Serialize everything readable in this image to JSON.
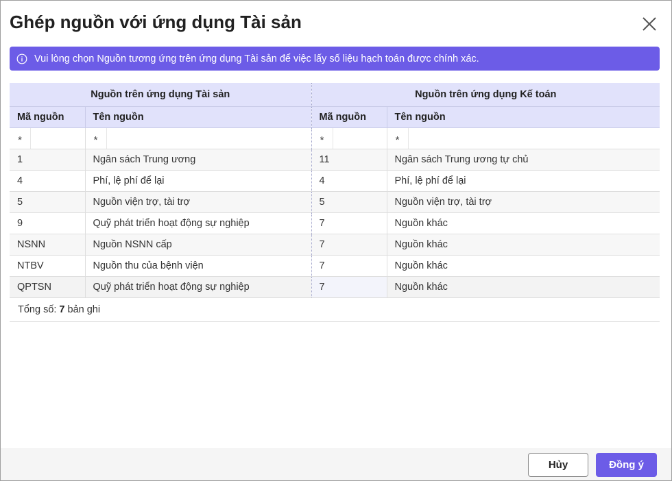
{
  "dialog": {
    "title": "Ghép nguồn với ứng dụng Tài sản",
    "close_icon": "close-icon"
  },
  "banner": {
    "icon": "info-icon",
    "text": "Vui lòng chọn Nguồn tương ứng trên ứng dụng Tài sản để việc lấy số liệu hạch toán được chính xác.",
    "color": "#6c5ce7"
  },
  "table": {
    "groups": {
      "asset": "Nguồn trên ứng dụng Tài sản",
      "accounting": "Nguồn trên ứng dụng Kế toán"
    },
    "columns": {
      "asset_code": "Mã nguồn",
      "asset_name": "Tên nguồn",
      "acc_code": "Mã nguồn",
      "acc_name": "Tên nguồn"
    },
    "filter_operator": "*",
    "rows": [
      {
        "asset_code": "1",
        "asset_name": "Ngân sách Trung ương",
        "acc_code": "11",
        "acc_name": "Ngân sách Trung ương tự chủ"
      },
      {
        "asset_code": "4",
        "asset_name": "Phí, lệ phí để lại",
        "acc_code": "4",
        "acc_name": "Phí, lệ phí để lại"
      },
      {
        "asset_code": "5",
        "asset_name": "Nguồn viện trợ, tài trợ",
        "acc_code": "5",
        "acc_name": "Nguồn viện trợ, tài trợ"
      },
      {
        "asset_code": "9",
        "asset_name": "Quỹ phát triển hoạt động sự nghiệp",
        "acc_code": "7",
        "acc_name": "Nguồn khác"
      },
      {
        "asset_code": "NSNN",
        "asset_name": "Nguồn NSNN cấp",
        "acc_code": "7",
        "acc_name": "Nguồn khác"
      },
      {
        "asset_code": "NTBV",
        "asset_name": "Nguồn thu của bệnh viện",
        "acc_code": "7",
        "acc_name": "Nguồn khác"
      },
      {
        "asset_code": "QPTSN",
        "asset_name": "Quỹ phát triển hoạt động sự nghiệp",
        "acc_code": "7",
        "acc_name": "Nguồn khác"
      }
    ]
  },
  "summary": {
    "prefix": "Tổng số:",
    "count": "7",
    "suffix": "bản ghi"
  },
  "actions": {
    "cancel_label": "Hủy",
    "ok_label": "Đồng ý",
    "accent": "#6c5ce7"
  }
}
